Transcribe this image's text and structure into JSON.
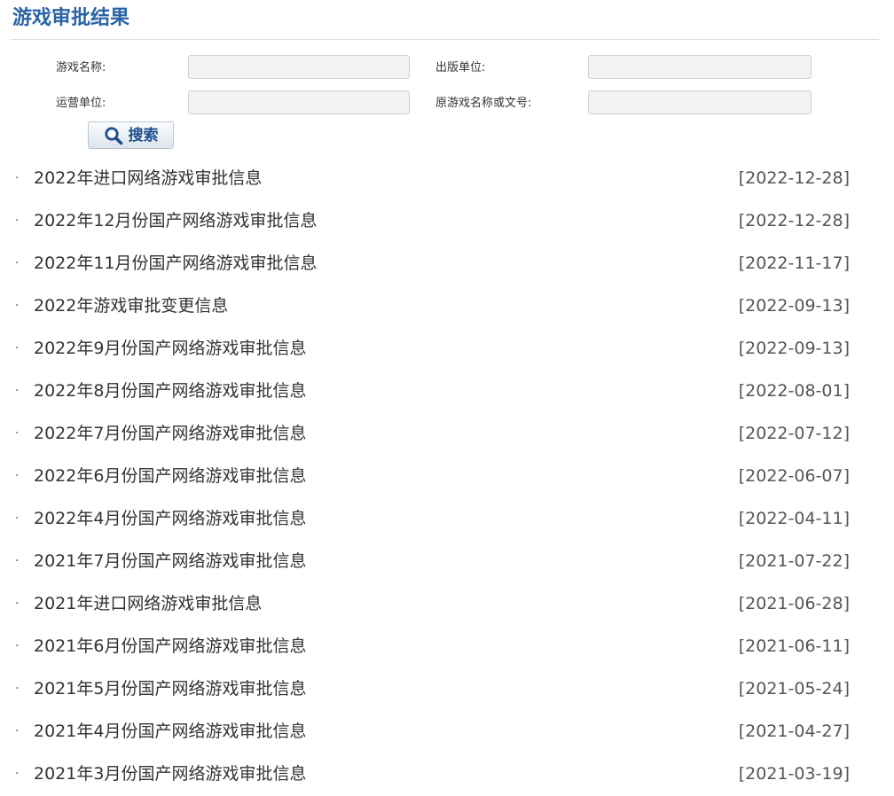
{
  "page": {
    "title": "游戏审批结果"
  },
  "search_form": {
    "game_name_label": "游戏名称:",
    "game_name_value": "",
    "publisher_label": "出版单位:",
    "publisher_value": "",
    "operator_label": "运营单位:",
    "operator_value": "",
    "original_name_label": "原游戏名称或文号:",
    "original_name_value": "",
    "search_button_label": "搜索",
    "search_icon": "magnifier-icon"
  },
  "list": {
    "bullet": "·",
    "items": [
      {
        "title": "2022年进口网络游戏审批信息",
        "date": "[2022-12-28]"
      },
      {
        "title": "2022年12月份国产网络游戏审批信息",
        "date": "[2022-12-28]"
      },
      {
        "title": "2022年11月份国产网络游戏审批信息",
        "date": "[2022-11-17]"
      },
      {
        "title": "2022年游戏审批变更信息",
        "date": "[2022-09-13]"
      },
      {
        "title": "2022年9月份国产网络游戏审批信息",
        "date": "[2022-09-13]"
      },
      {
        "title": "2022年8月份国产网络游戏审批信息",
        "date": "[2022-08-01]"
      },
      {
        "title": "2022年7月份国产网络游戏审批信息",
        "date": "[2022-07-12]"
      },
      {
        "title": "2022年6月份国产网络游戏审批信息",
        "date": "[2022-06-07]"
      },
      {
        "title": "2022年4月份国产网络游戏审批信息",
        "date": "[2022-04-11]"
      },
      {
        "title": "2021年7月份国产网络游戏审批信息",
        "date": "[2021-07-22]"
      },
      {
        "title": "2021年进口网络游戏审批信息",
        "date": "[2021-06-28]"
      },
      {
        "title": "2021年6月份国产网络游戏审批信息",
        "date": "[2021-06-11]"
      },
      {
        "title": "2021年5月份国产网络游戏审批信息",
        "date": "[2021-05-24]"
      },
      {
        "title": "2021年4月份国产网络游戏审批信息",
        "date": "[2021-04-27]"
      },
      {
        "title": "2021年3月份国产网络游戏审批信息",
        "date": "[2021-03-19]"
      }
    ]
  },
  "colors": {
    "title": "#2b64a6",
    "text": "#333333",
    "date": "#555555",
    "input_bg": "#f2f2f4",
    "input_border": "#cfcfcf",
    "button_text": "#1f4f8f"
  }
}
